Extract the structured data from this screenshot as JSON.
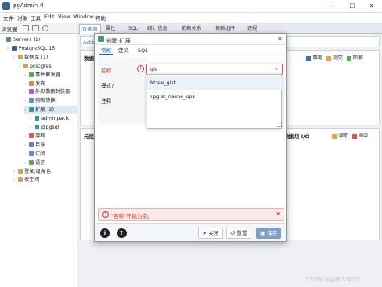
{
  "window": {
    "title": "pgAdmin 4",
    "min_glyph": "—",
    "max_glyph": "☐",
    "close_glyph": "✕"
  },
  "menu": [
    "文件",
    "对象",
    "工具",
    "Edit",
    "View",
    "Window",
    "帮助"
  ],
  "toolbar": {
    "label": "浏览器"
  },
  "tree": [
    {
      "label": "Servers (1)",
      "indent": 0,
      "color": "#6e7f99"
    },
    {
      "label": "PostgreSQL 15",
      "indent": 1,
      "color": "#336791"
    },
    {
      "label": "数据库 (1)",
      "indent": 2,
      "color": "#c7a35b"
    },
    {
      "label": "postgres",
      "indent": 3,
      "color": "#c7a35b"
    },
    {
      "label": "事件触发器",
      "indent": 4,
      "color": "#5fa55a"
    },
    {
      "label": "发布",
      "indent": 4,
      "color": "#d98b3a"
    },
    {
      "label": "外部数据封装器",
      "indent": 4,
      "color": "#8a6bbf"
    },
    {
      "label": "强制转换",
      "indent": 4,
      "color": "#5f8fc7"
    },
    {
      "label": "扩展 (2)",
      "indent": 4,
      "color": "#3a9a8a",
      "selected": true
    },
    {
      "label": "adminpack",
      "indent": 5,
      "color": "#3a9a8a"
    },
    {
      "label": "plpgsql",
      "indent": 5,
      "color": "#3a9a8a"
    },
    {
      "label": "架构",
      "indent": 4,
      "color": "#c75f5f"
    },
    {
      "label": "目录",
      "indent": 4,
      "color": "#8a6bbf"
    },
    {
      "label": "订阅",
      "indent": 4,
      "color": "#5f8fc7"
    },
    {
      "label": "语言",
      "indent": 4,
      "color": "#5fa55a"
    },
    {
      "label": "登录/组角色",
      "indent": 2,
      "color": "#c7a35b"
    },
    {
      "label": "表空间",
      "indent": 2,
      "color": "#c7a35b"
    }
  ],
  "tabs": [
    "仪表盘",
    "属性",
    "SQL",
    "统计信息",
    "依赖关系",
    "依赖组件",
    "进程"
  ],
  "main": {
    "activity_label": "Activi",
    "panel_top_title": "数据",
    "panel_bottom_left_title": "元组",
    "panel_bottom_right_title": "数据块 I/O",
    "legend_top": [
      {
        "label": "事务",
        "color": "#3b6fb6"
      },
      {
        "label": "提交",
        "color": "#e8a23a"
      },
      {
        "label": "回滚",
        "color": "#5aa55a"
      }
    ],
    "legend_bottom": [
      {
        "label": "读取",
        "color": "#e8a23a"
      },
      {
        "label": "命中",
        "color": "#d9534f"
      }
    ]
  },
  "dialog": {
    "title": "创建-扩展",
    "tabs": [
      "常规",
      "定义",
      "SQL"
    ],
    "labels": {
      "name": "名称",
      "schema": "模式?",
      "comment": "注释"
    },
    "name_value": "gis",
    "options": [
      "btree_gist",
      "spgist_name_ops"
    ],
    "error": "\"名称\"不能为空。",
    "buttons": {
      "close": "关闭",
      "reset": "重置",
      "save": "保存"
    }
  },
  "watermark": "CSDN @蓝眸少年CY"
}
